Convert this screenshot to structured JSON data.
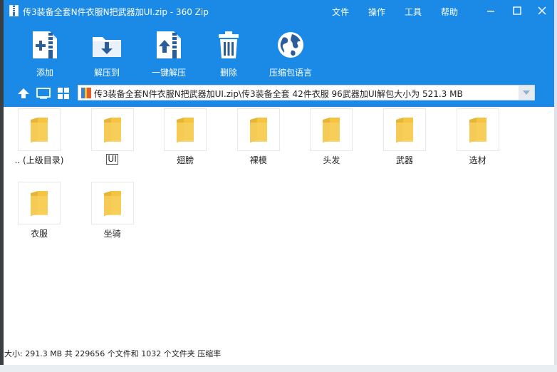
{
  "window": {
    "title": "传3装备全套N件衣服N把武器加UI.zip - 360 Zip",
    "menu": [
      "文件",
      "操作",
      "工具",
      "帮助"
    ]
  },
  "toolbar": {
    "add": "添加",
    "extract_to": "解压到",
    "one_click": "一键解压",
    "delete": "删除",
    "language": "压缩包语言"
  },
  "address": {
    "path": "传3装备全套N件衣服N把武器加UI.zip\\传3装备全套 42件衣服 96武器加UI解包大小为 521.3 MB"
  },
  "files": [
    {
      "name": ".. (上级目录)"
    },
    {
      "name": "UI"
    },
    {
      "name": "翅膀"
    },
    {
      "name": "裸模"
    },
    {
      "name": "头发"
    },
    {
      "name": "武器"
    },
    {
      "name": "选材"
    },
    {
      "name": "衣服"
    },
    {
      "name": "坐骑"
    }
  ],
  "status": {
    "text": "大小: 291.3 MB 共 229656 个文件和 1032 个文件夹 压缩率"
  },
  "colors": {
    "accent": "#1a8ae6",
    "folder": "#f5c542"
  }
}
